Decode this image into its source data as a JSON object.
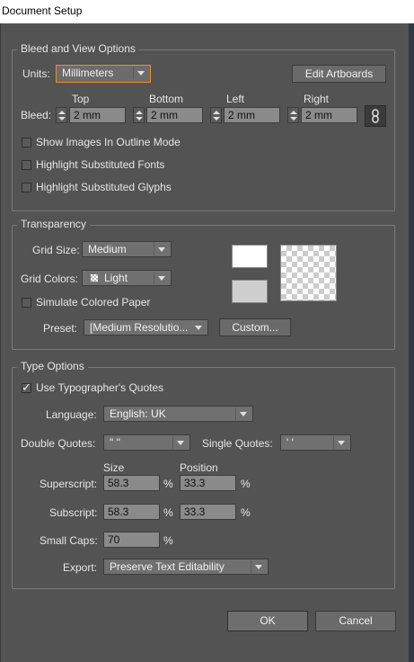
{
  "window": {
    "title": "Document Setup"
  },
  "bleed_view": {
    "legend": "Bleed and View Options",
    "units_label": "Units:",
    "units_value": "Millimeters",
    "edit_artboards": "Edit Artboards",
    "bleed_label": "Bleed:",
    "headers": {
      "top": "Top",
      "bottom": "Bottom",
      "left": "Left",
      "right": "Right"
    },
    "values": {
      "top": "2 mm",
      "bottom": "2 mm",
      "left": "2 mm",
      "right": "2 mm"
    },
    "checks": {
      "show_images_outline": "Show Images In Outline Mode",
      "highlight_fonts": "Highlight Substituted Fonts",
      "highlight_glyphs": "Highlight Substituted Glyphs"
    }
  },
  "transparency": {
    "legend": "Transparency",
    "grid_size_label": "Grid Size:",
    "grid_size_value": "Medium",
    "grid_colors_label": "Grid Colors:",
    "grid_colors_value": "Light",
    "simulate_paper": "Simulate Colored Paper",
    "preset_label": "Preset:",
    "preset_value": "[Medium Resolutio...",
    "custom_button": "Custom..."
  },
  "type_options": {
    "legend": "Type Options",
    "typographers_quotes": "Use Typographer's Quotes",
    "typographers_quotes_checked": true,
    "language_label": "Language:",
    "language_value": "English: UK",
    "double_quotes_label": "Double Quotes:",
    "double_quotes_value": "\" \"",
    "single_quotes_label": "Single Quotes:",
    "single_quotes_value": "' '",
    "size_header": "Size",
    "position_header": "Position",
    "superscript_label": "Superscript:",
    "superscript_size": "58.3",
    "superscript_position": "33.3",
    "subscript_label": "Subscript:",
    "subscript_size": "58.3",
    "subscript_position": "33.3",
    "small_caps_label": "Small Caps:",
    "small_caps_value": "70",
    "percent": "%",
    "export_label": "Export:",
    "export_value": "Preserve Text Editability"
  },
  "buttons": {
    "ok": "OK",
    "cancel": "Cancel"
  },
  "colors": {
    "dialog_bg": "#535353",
    "field_bg": "#8a8a8a",
    "accent_border": "#e8902c"
  }
}
